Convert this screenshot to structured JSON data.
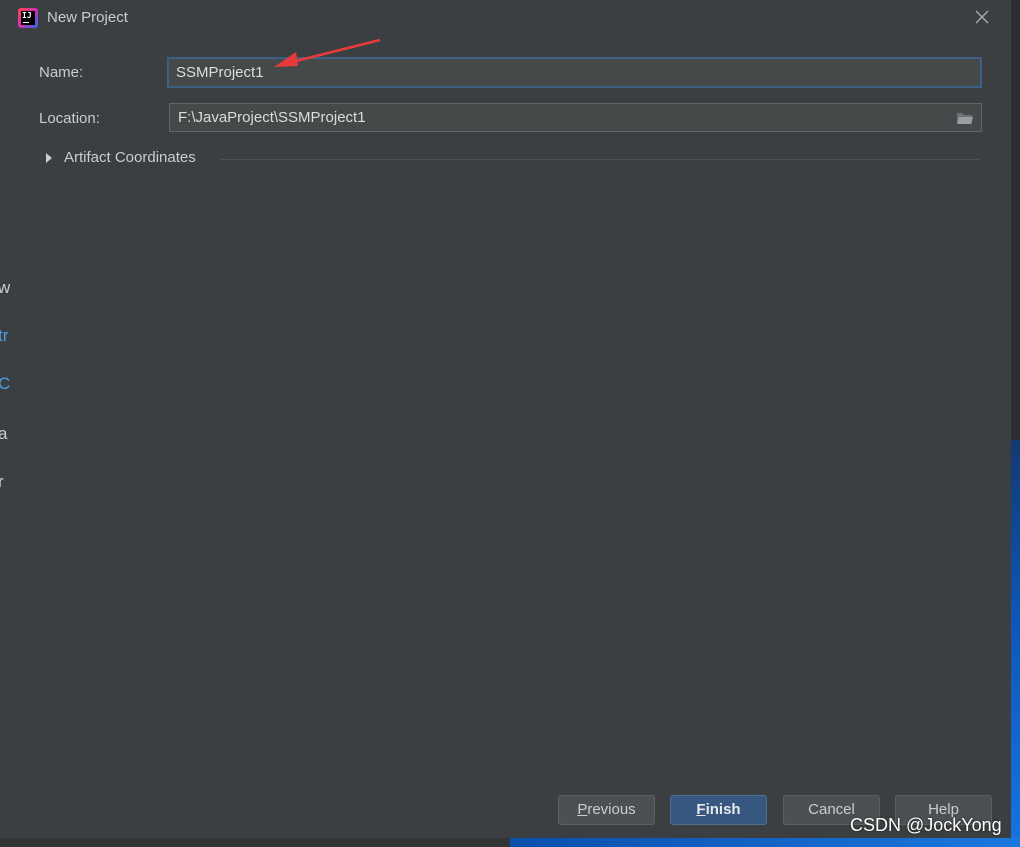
{
  "background": {
    "fragments": [
      "w",
      "tr",
      "C",
      "a",
      "r"
    ]
  },
  "dialog": {
    "title": "New Project",
    "close_icon": "close-icon",
    "name_label": "Name:",
    "name_value": "SSMProject1",
    "location_label": "Location:",
    "location_value": "F:\\JavaProject\\SSMProject1",
    "artifact_label": "Artifact Coordinates",
    "buttons": {
      "previous": {
        "mnemonic": "P",
        "rest": "revious"
      },
      "finish": {
        "mnemonic": "F",
        "rest": "inish"
      },
      "cancel": "Cancel",
      "help": "Help"
    }
  },
  "watermark": "CSDN @JockYong",
  "colors": {
    "dialog_bg": "#3c3f41",
    "field_bg": "#45494a",
    "focus_border": "#3d6185",
    "primary_button": "#365880",
    "arrow": "#e83a3a"
  }
}
